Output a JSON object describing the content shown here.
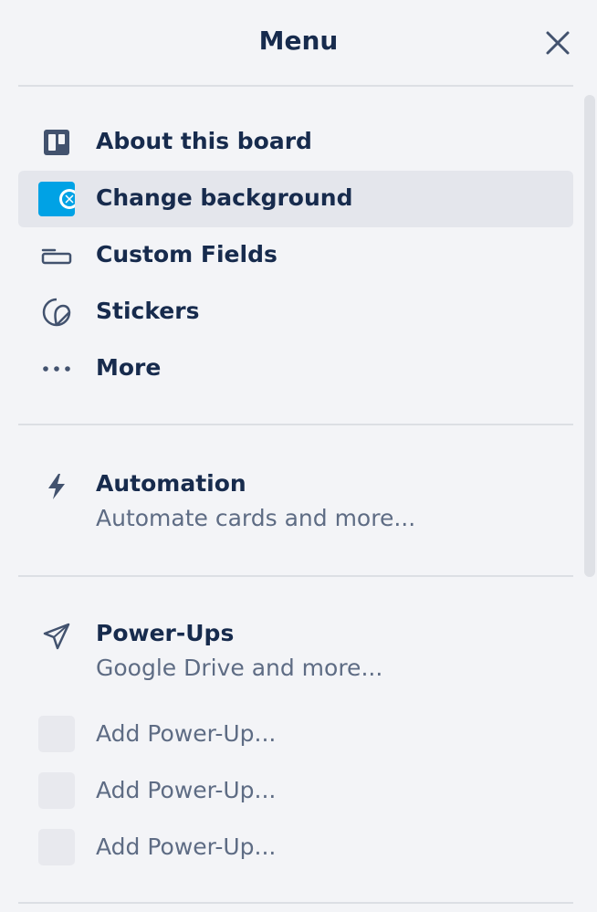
{
  "header": {
    "title": "Menu",
    "close_icon": "close-icon"
  },
  "menu_items": [
    {
      "label": "About this board",
      "icon": "board-icon"
    },
    {
      "label": "Change background",
      "icon": "background-icon",
      "selected": true
    },
    {
      "label": "Custom Fields",
      "icon": "custom-fields-icon"
    },
    {
      "label": "Stickers",
      "icon": "sticker-icon"
    },
    {
      "label": "More",
      "icon": "more-icon"
    }
  ],
  "automation": {
    "title": "Automation",
    "subtitle": "Automate cards and more...",
    "icon": "lightning-icon"
  },
  "powerups": {
    "title": "Power-Ups",
    "subtitle": "Google Drive and more...",
    "icon": "rocket-icon",
    "items": [
      {
        "label": "Add Power-Up..."
      },
      {
        "label": "Add Power-Up..."
      },
      {
        "label": "Add Power-Up..."
      }
    ]
  },
  "colors": {
    "text": "#172b4d",
    "subtext": "#5e6c84",
    "accent": "#00a2e5",
    "background": "#f3f4f7",
    "selected": "#e4e6ec"
  }
}
